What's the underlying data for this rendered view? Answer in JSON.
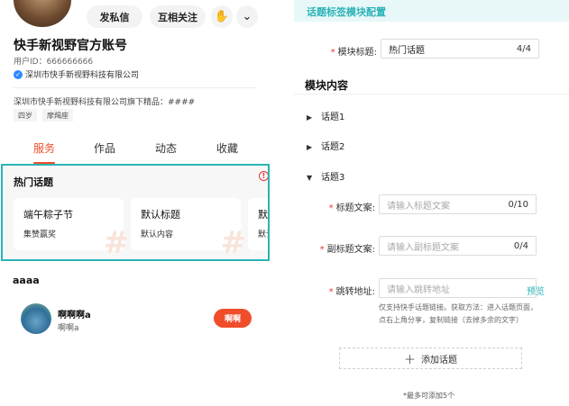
{
  "profile": {
    "message_button": "发私信",
    "follow_button": "互相关注",
    "account_name": "快手新视野官方账号",
    "user_id": "用户ID：666666666",
    "verified_org": "深圳市快手新视野科技有限公司",
    "description": "深圳市快手新视野科技有限公司旗下精品：####",
    "tags": [
      "四岁",
      "摩羯座"
    ]
  },
  "tabs": [
    "服务",
    "作品",
    "动态",
    "收藏"
  ],
  "hot_topics": {
    "title": "热门话题",
    "cards": [
      {
        "title": "端午粽子节",
        "subtitle": "集赞赢奖"
      },
      {
        "title": "默认标题",
        "subtitle": "默认内容"
      },
      {
        "title": "默认",
        "subtitle": "默认"
      }
    ]
  },
  "next_module": {
    "title": "aaaa",
    "user_name": "啊啊啊a",
    "user_sub": "啊啊a",
    "action_button": "啊啊"
  },
  "config": {
    "header": "话题标签模块配置",
    "module_title_label": "模块标题:",
    "module_title_value": "热门话题",
    "module_title_count": "4/4",
    "section_title": "模块内容",
    "topics": [
      "话题1",
      "话题2",
      "话题3"
    ],
    "title_text_label": "标题文案:",
    "title_text_placeholder": "请输入标题文案",
    "title_text_count": "0/10",
    "subtitle_text_label": "副标题文案:",
    "subtitle_text_placeholder": "请输入副标题文案",
    "subtitle_text_count": "0/4",
    "jump_label": "跳转地址:",
    "jump_placeholder": "请输入跳转地址",
    "preview_link": "预览",
    "jump_hint": "仅支持快手话题链接。获取方法：进入话题页面，点右上角分享，复制链接（去掉多余的文字）",
    "add_button": "添加话题",
    "add_limit": "*最多可添加5个"
  },
  "colors": {
    "accent": "#f04d2a",
    "teal": "#2bb3b6",
    "required": "#e33333"
  }
}
